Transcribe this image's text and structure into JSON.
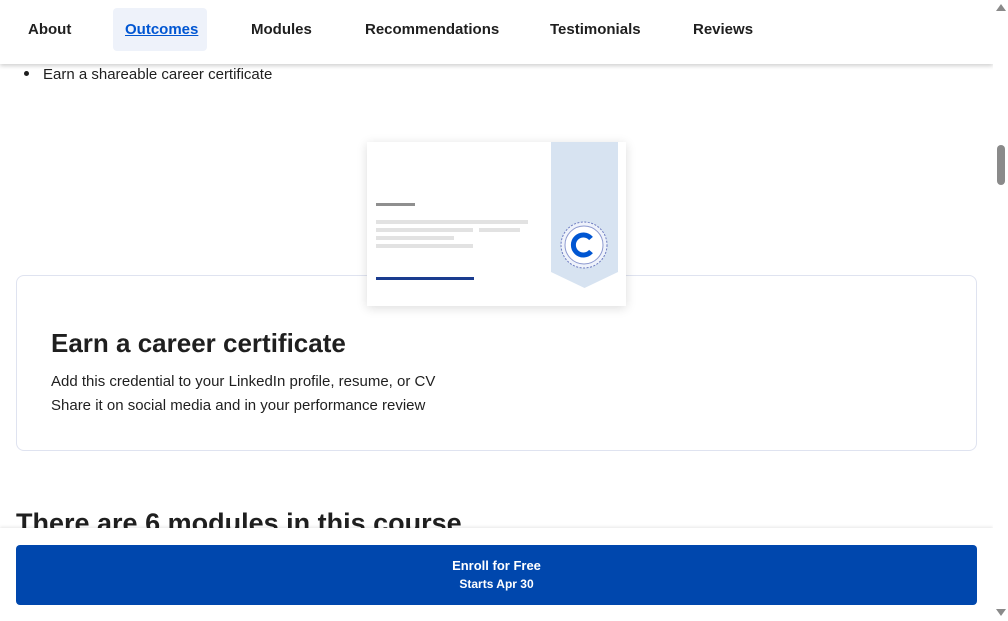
{
  "nav": {
    "tabs": [
      {
        "label": "About"
      },
      {
        "label": "Outcomes",
        "active": true
      },
      {
        "label": "Modules"
      },
      {
        "label": "Recommendations"
      },
      {
        "label": "Testimonials"
      },
      {
        "label": "Reviews"
      }
    ]
  },
  "outcomes": {
    "bullet": "Earn a shareable career certificate"
  },
  "certificate": {
    "title": "Earn a career certificate",
    "lines": [
      "Add this credential to your LinkedIn profile, resume, or CV",
      "Share it on social media and in your performance review"
    ],
    "seal_letter": "C"
  },
  "modules": {
    "heading": "There are 6 modules in this course"
  },
  "enroll": {
    "label": "Enroll for Free",
    "sub": "Starts Apr 30"
  },
  "colors": {
    "accent": "#0056d2",
    "button": "#0047ad"
  }
}
